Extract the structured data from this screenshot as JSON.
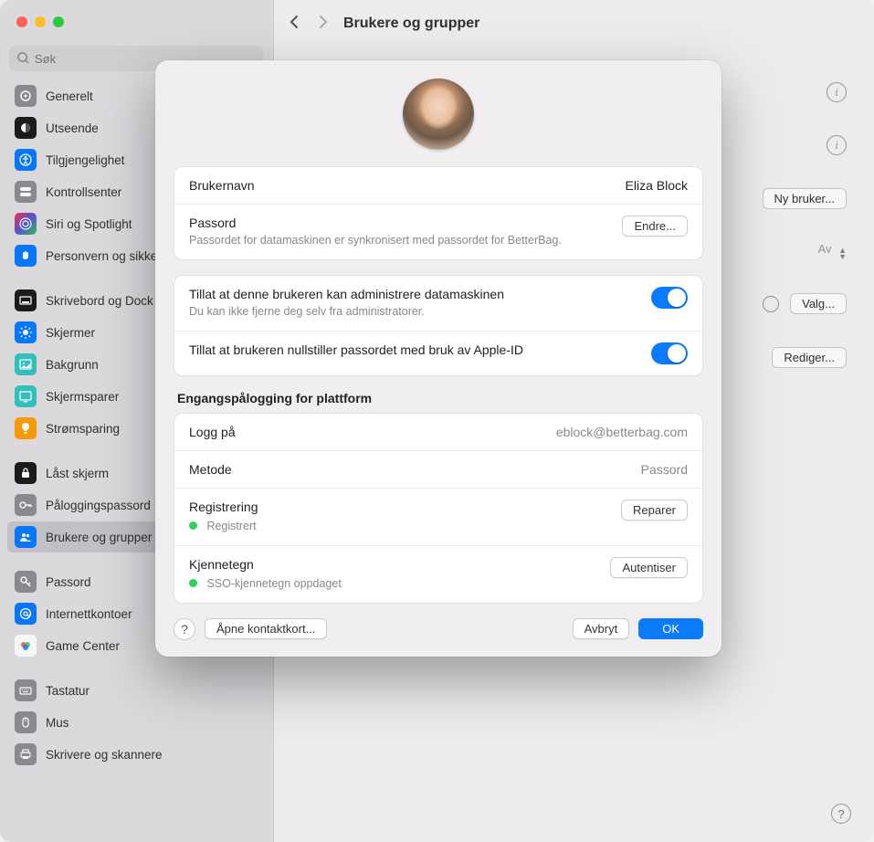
{
  "window": {
    "title": "Brukere og grupper",
    "search_placeholder": "Søk"
  },
  "sidebar": {
    "items": [
      {
        "label": "Generelt",
        "icon": "gear",
        "bg": "#8e8e93"
      },
      {
        "label": "Utseende",
        "icon": "appearance",
        "bg": "#1c1c1e"
      },
      {
        "label": "Tilgjengelighet",
        "icon": "accessibility",
        "bg": "#0a7aff"
      },
      {
        "label": "Kontrollsenter",
        "icon": "switches",
        "bg": "#8e8e93"
      },
      {
        "label": "Siri og Spotlight",
        "icon": "siri",
        "bg": "grad-siri"
      },
      {
        "label": "Personvern og sikkerhet",
        "icon": "hand",
        "bg": "#0a7aff"
      }
    ],
    "items2": [
      {
        "label": "Skrivebord og Dock",
        "icon": "dock",
        "bg": "#1c1c1e"
      },
      {
        "label": "Skjermer",
        "icon": "brightness",
        "bg": "#0a7aff"
      },
      {
        "label": "Bakgrunn",
        "icon": "wallpaper",
        "bg": "#35c7c0"
      },
      {
        "label": "Skjermsparer",
        "icon": "screensaver",
        "bg": "#35c7c0"
      },
      {
        "label": "Strømsparing",
        "icon": "bulb",
        "bg": "#ff9f0a"
      }
    ],
    "items3": [
      {
        "label": "Låst skjerm",
        "icon": "lock",
        "bg": "#1c1c1e"
      },
      {
        "label": "Påloggingspassord",
        "icon": "key",
        "bg": "#8e8e93"
      },
      {
        "label": "Brukere og grupper",
        "icon": "users",
        "bg": "#0a7aff",
        "selected": true
      }
    ],
    "items4": [
      {
        "label": "Passord",
        "icon": "key2",
        "bg": "#8e8e93"
      },
      {
        "label": "Internettkontoer",
        "icon": "at",
        "bg": "#0a7aff"
      },
      {
        "label": "Game Center",
        "icon": "gamecenter",
        "bg": "grad-gc"
      }
    ],
    "items5": [
      {
        "label": "Tastatur",
        "icon": "keyboard",
        "bg": "#8e8e93"
      },
      {
        "label": "Mus",
        "icon": "mouse",
        "bg": "#8e8e93"
      },
      {
        "label": "Skrivere og skannere",
        "icon": "printer",
        "bg": "#8e8e93"
      }
    ]
  },
  "background_panel": {
    "new_user": "Ny bruker...",
    "dropdown_value": "Av",
    "options": "Valg...",
    "edit": "Rediger..."
  },
  "modal": {
    "username_label": "Brukernavn",
    "username_value": "Eliza Block",
    "password_label": "Passord",
    "password_sub": "Passordet for datamaskinen er synkronisert med passordet for BetterBag.",
    "password_button": "Endre...",
    "admin_label": "Tillat at denne brukeren kan administrere datamaskinen",
    "admin_sub": "Du kan ikke fjerne deg selv fra administratorer.",
    "reset_label": "Tillat at brukeren nullstiller passordet med bruk av Apple-ID",
    "sso_title": "Engangspålogging for plattform",
    "login_label": "Logg på",
    "login_value": "eblock@betterbag.com",
    "method_label": "Metode",
    "method_value": "Passord",
    "registration_label": "Registrering",
    "registration_status": "Registrert",
    "registration_button": "Reparer",
    "token_label": "Kjennetegn",
    "token_status": "SSO-kjennetegn oppdaget",
    "token_button": "Autentiser",
    "open_contact": "Åpne kontaktkort...",
    "cancel": "Avbryt",
    "ok": "OK"
  }
}
